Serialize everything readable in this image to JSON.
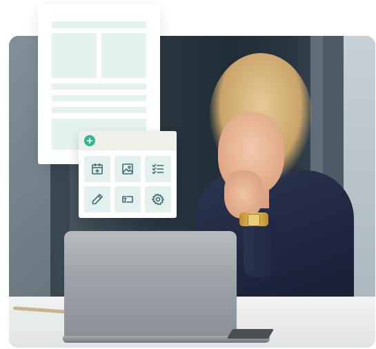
{
  "toolbox": {
    "add_icon": "plus-circle-icon",
    "accent_color": "#2eb88a",
    "icon_color": "#3d6a73",
    "tile_color": "#e3f0ee",
    "tools": [
      {
        "icon": "calendar-add-icon"
      },
      {
        "icon": "image-icon"
      },
      {
        "icon": "checklist-icon"
      },
      {
        "icon": "pencil-icon"
      },
      {
        "icon": "text-field-icon"
      },
      {
        "icon": "gear-icon"
      }
    ]
  },
  "document_mockup": {
    "block_color": "#e5f3ee"
  }
}
